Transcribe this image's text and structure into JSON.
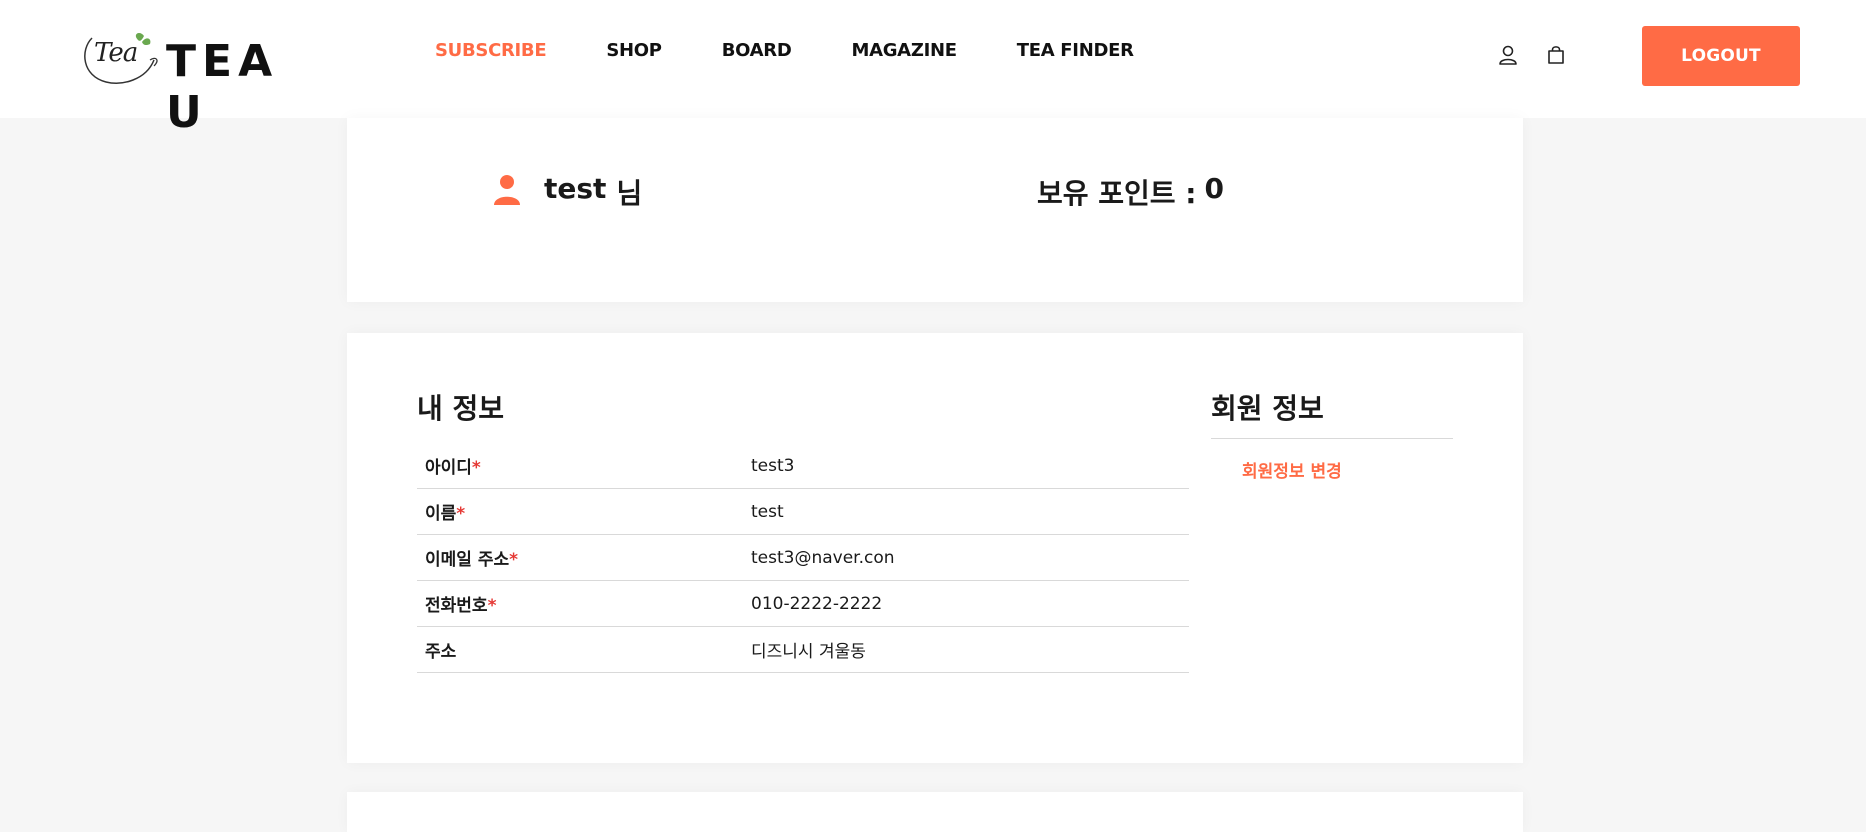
{
  "header": {
    "logo_script": "Tea",
    "logo_brand": "TEA U",
    "nav": [
      "SUBSCRIBE",
      "SHOP",
      "BOARD",
      "MAGAZINE",
      "TEA FINDER"
    ],
    "active_nav": "SUBSCRIBE",
    "icons": [
      "user-icon",
      "cart-icon"
    ],
    "logout_label": "LOGOUT"
  },
  "summary": {
    "username": "test",
    "honorific": "님",
    "points_label": "보유 포인트 :",
    "points_value": "0"
  },
  "info": {
    "title": "내 정보",
    "rows": [
      {
        "label": "아이디",
        "required": "*",
        "value": "test3"
      },
      {
        "label": "이름",
        "required": "*",
        "value": "test"
      },
      {
        "label": "이메일 주소",
        "required": "*",
        "value": "test3@naver.con"
      },
      {
        "label": "전화번호",
        "required": "*",
        "value": "010-2222-2222"
      },
      {
        "label": "주소",
        "required": "",
        "value": "디즈니시 겨울동"
      }
    ]
  },
  "member": {
    "title": "회원 정보",
    "link": "회원정보 변경"
  },
  "colors": {
    "accent": "#ff6b45",
    "required": "#e53935",
    "background": "#f6f6f6"
  }
}
